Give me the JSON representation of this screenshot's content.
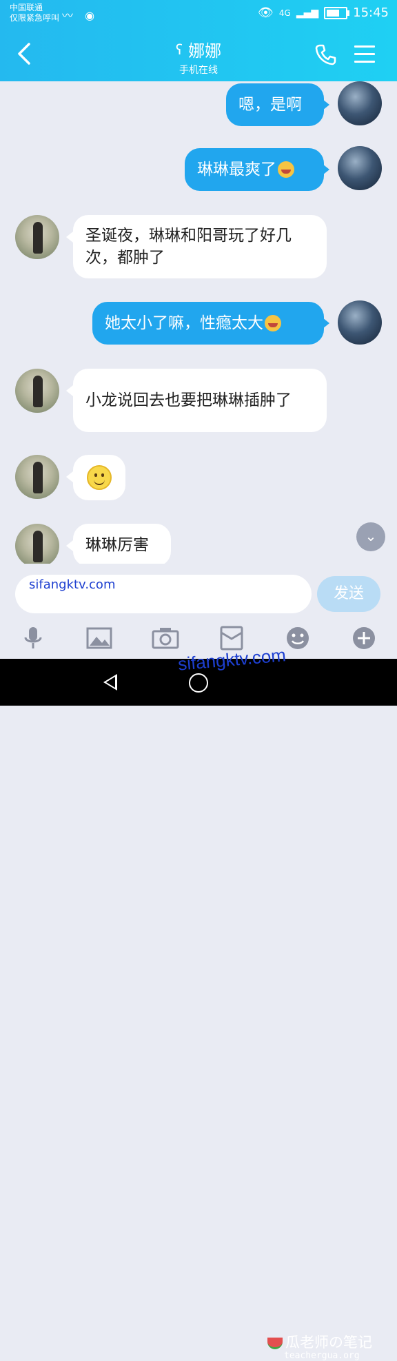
{
  "status_bar": {
    "carrier_line1": "中国联通",
    "carrier_line2": "仅限紧急呼叫",
    "signal_label": "4G",
    "time": "15:45"
  },
  "header": {
    "title": "娜娜",
    "subtitle": "手机在线"
  },
  "messages": [
    {
      "side": "out",
      "text": "嗯，是啊"
    },
    {
      "side": "out",
      "text": "琳琳最爽了",
      "emoji": "laughing-tears"
    },
    {
      "side": "in",
      "text": "圣诞夜，琳琳和阳哥玩了好几次，都肿了"
    },
    {
      "side": "out",
      "text": "她太小了嘛，性瘾太大",
      "emoji": "laughing-tears"
    },
    {
      "side": "in",
      "text": "小龙说回去也要把琳琳插肿了"
    },
    {
      "side": "in",
      "text": "",
      "emoji": "smile"
    },
    {
      "side": "in",
      "text": "琳琳厉害"
    }
  ],
  "input": {
    "value": "sifangktv.com",
    "send_label": "发送"
  },
  "toolbar": [
    "mic-icon",
    "image-icon",
    "camera-icon",
    "red-packet-icon",
    "emoji-icon",
    "plus-icon"
  ],
  "watermarks": {
    "center": "sifangktv.com",
    "brand": "瓜老师の笔记",
    "url": "teachergua.org"
  },
  "colors": {
    "header": "#24b9ef",
    "out_bubble": "#21a6ee",
    "in_bubble": "#ffffff",
    "background": "#e9ebf3"
  }
}
